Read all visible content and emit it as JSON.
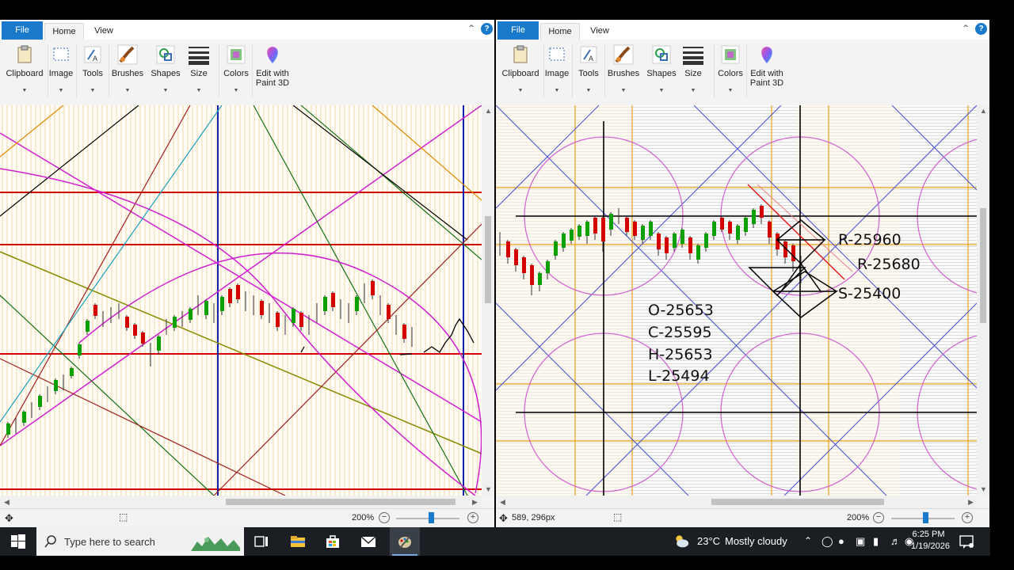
{
  "left": {
    "tabs": {
      "file": "File",
      "home": "Home",
      "view": "View"
    },
    "help_label": "?",
    "ribbon": [
      {
        "label": "Clipboard"
      },
      {
        "label": "Image"
      },
      {
        "label": "Tools"
      },
      {
        "label": "Brushes"
      },
      {
        "label": "Shapes"
      },
      {
        "label": "Size"
      },
      {
        "label": "Colors"
      },
      {
        "label": "Edit with\nPaint 3D"
      }
    ],
    "status": {
      "cursor_pos": "",
      "zoom": "200%"
    }
  },
  "right": {
    "tabs": {
      "file": "File",
      "home": "Home",
      "view": "View"
    },
    "help_label": "?",
    "ribbon": [
      {
        "label": "Clipboard"
      },
      {
        "label": "Image"
      },
      {
        "label": "Tools"
      },
      {
        "label": "Brushes"
      },
      {
        "label": "Shapes"
      },
      {
        "label": "Size"
      },
      {
        "label": "Colors"
      },
      {
        "label": "Edit with\nPaint 3D"
      }
    ],
    "status": {
      "cursor_pos": "589, 296px",
      "zoom": "200%"
    },
    "annotations": {
      "resist1": "R-25960",
      "resist2": "R-25680",
      "support": "S-25400",
      "open": "O-25653",
      "close": "C-25595",
      "high": "H-25653",
      "low": "L-25494"
    }
  },
  "taskbar": {
    "search_placeholder": "Type here to search",
    "weather_temp": "23°C",
    "weather_text": "Mostly cloudy",
    "time": "6:25 PM",
    "date": "1/19/2026"
  }
}
